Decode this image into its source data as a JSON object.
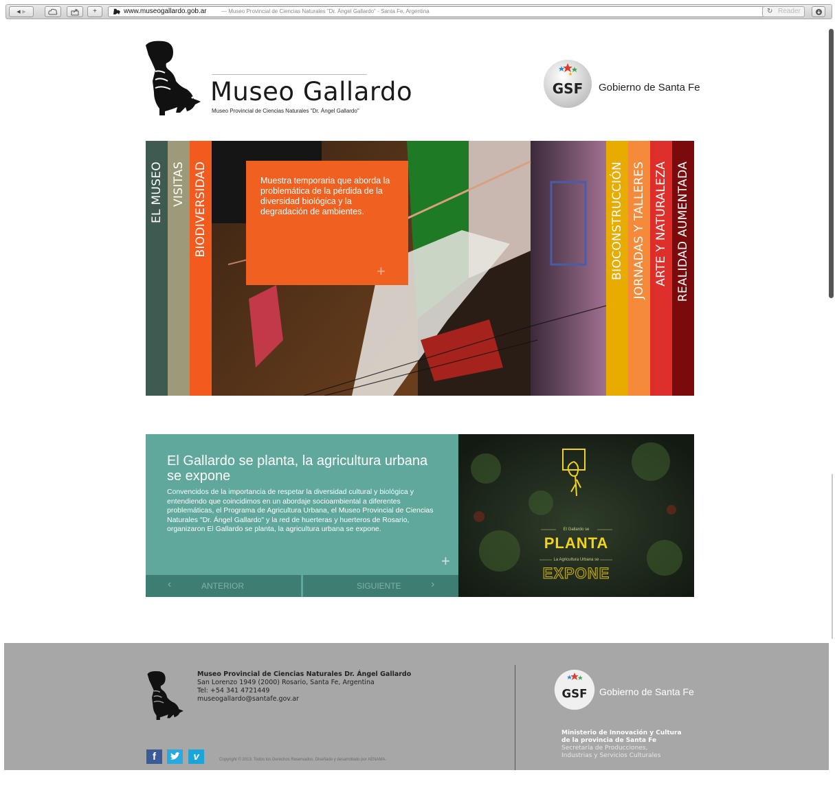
{
  "browser": {
    "url_domain": "www.museogallardo.gob.ar",
    "url_title": "— Museo Provincial de Ciencias Naturales \"Dr. Ángel Gallardo\" - Santa Fe, Argentina",
    "reader_label": "Reader",
    "back_glyph": "◀",
    "forward_glyph": "▶",
    "add_glyph": "+"
  },
  "header": {
    "logo_title": "Museo Gallardo",
    "logo_subtitle": "Museo Provincial de Ciencias Naturales \"Dr. Ángel Gallardo\"",
    "gsf_badge": "GSF",
    "gsf_text": "Gobierno de Santa Fe"
  },
  "banner": {
    "left_tabs": [
      {
        "label": "EL MUSEO",
        "color": "#3f5a50"
      },
      {
        "label": "VISITAS",
        "color": "#9c9a78"
      },
      {
        "label": "BIODIVERSIDAD",
        "color": "#f25a1e"
      }
    ],
    "right_tabs": [
      {
        "label": "BIOCONSTRUCCIÓN",
        "color": "#e8ac00"
      },
      {
        "label": "JORNADAS Y TALLERES",
        "color": "#f58a3a"
      },
      {
        "label": "ARTE Y NATURALEZA",
        "color": "#de2f2a"
      },
      {
        "label": "REALIDAD AUMENTADA",
        "color": "#7a0a0c"
      }
    ],
    "highlight_text": "Muestra temporaria que aborda la problemática de la pérdida de la diversidad biológica y la degradación de ambientes.",
    "highlight_plus": "+"
  },
  "feature": {
    "title": "El Gallardo se planta, la agricultura urbana se expone",
    "description": "Convencidos de la importancia de respetar la diversidad cultural y biológica y entendiendo que coincidimos en un abordaje socioambiental a diferentes problemáticas, el Programa de Agricultura Urbana, el Museo Provincial de Ciencias Naturales \"Dr. Ángel Gallardo\" y la red de huerteras y huerteros de Rosario, organizaron El Gallardo se planta, la agricultura urbana se expone.",
    "plus": "+",
    "prev_label": "ANTERIOR",
    "next_label": "SIGUIENTE",
    "prev_glyph": "‹",
    "next_glyph": "›",
    "poster": {
      "small_top": "El Gallardo se",
      "big_top": "PLANTA",
      "small_mid": "La Agricultura Urbana se",
      "big_bottom": "EXPONE"
    }
  },
  "footer": {
    "museum_name": "Museo Provincial de Ciencias Naturales Dr. Ángel Gallardo",
    "address": "San Lorenzo 1949 (2000) Rosario, Santa Fe, Argentina",
    "phone": "Tel: +54 341 4721449",
    "email": "museogallardo@santafe.gov.ar",
    "copyright": "Copyright © 2013. Todos los Derechos Reservados. Diseñado y desarrollado por AENAMA.",
    "social": {
      "facebook": "f",
      "twitter": "t",
      "vimeo": "v"
    },
    "gsf_badge": "GSF",
    "gsf_text": "Gobierno de Santa Fe",
    "ministry_line1": "Ministerio de Innovación y Cultura",
    "ministry_line2": "de la provincia de Santa Fe",
    "secretary_line1": "Secretaría de Producciones,",
    "secretary_line2": "Industrias y Servicios Culturales"
  }
}
